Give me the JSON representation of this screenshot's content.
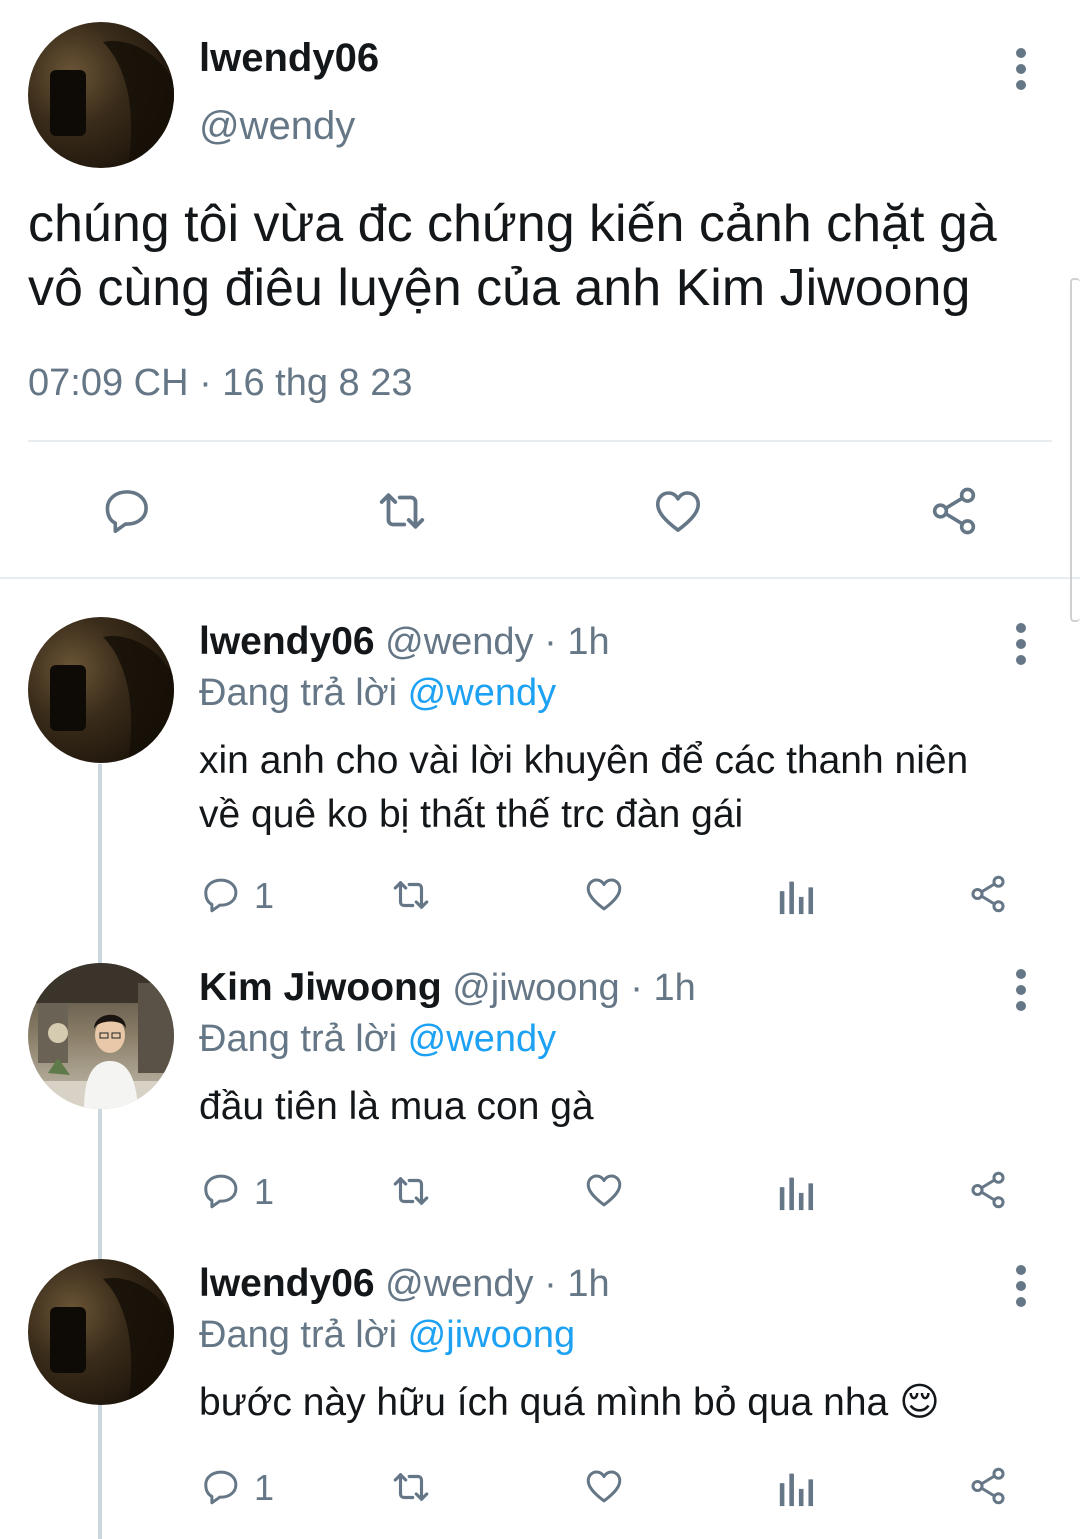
{
  "main_tweet": {
    "display_name": "lwendy06",
    "handle": "@wendy",
    "text_line1": "chúng tôi vừa đc chứng kiến cảnh chặt gà",
    "text_line2": "vô cùng điêu luyện của anh Kim Jiwoong",
    "timestamp": "07:09 CH · 16 thg 8 23",
    "actions": [
      "reply-icon",
      "retweet-icon",
      "like-icon",
      "share-icon"
    ]
  },
  "replies": [
    {
      "display_name": "lwendy06",
      "handle": "@wendy",
      "time": "1h",
      "replying_label": "Đang trả lời",
      "replying_to": "@wendy",
      "text_line1": "xin anh cho vài lời khuyên để các thanh niên",
      "text_line2": "về quê ko bị thất thế trc đàn gái",
      "reply_count": "1"
    },
    {
      "display_name": "Kim Jiwoong",
      "handle": "@jiwoong",
      "time": "1h",
      "replying_label": "Đang trả lời",
      "replying_to": "@wendy",
      "text_line1": "đầu tiên là mua con gà",
      "reply_count": "1"
    },
    {
      "display_name": "lwendy06",
      "handle": "@wendy",
      "time": "1h",
      "replying_label": "Đang trả lời",
      "replying_to": "@jiwoong",
      "text_line1": "bước này hữu ích quá mình bỏ qua nha",
      "emoji": "😌",
      "reply_count": "1"
    }
  ],
  "colors": {
    "text": "#14171a",
    "secondary": "#657786",
    "link": "#1da1f2",
    "divider": "#e6ecf0"
  }
}
